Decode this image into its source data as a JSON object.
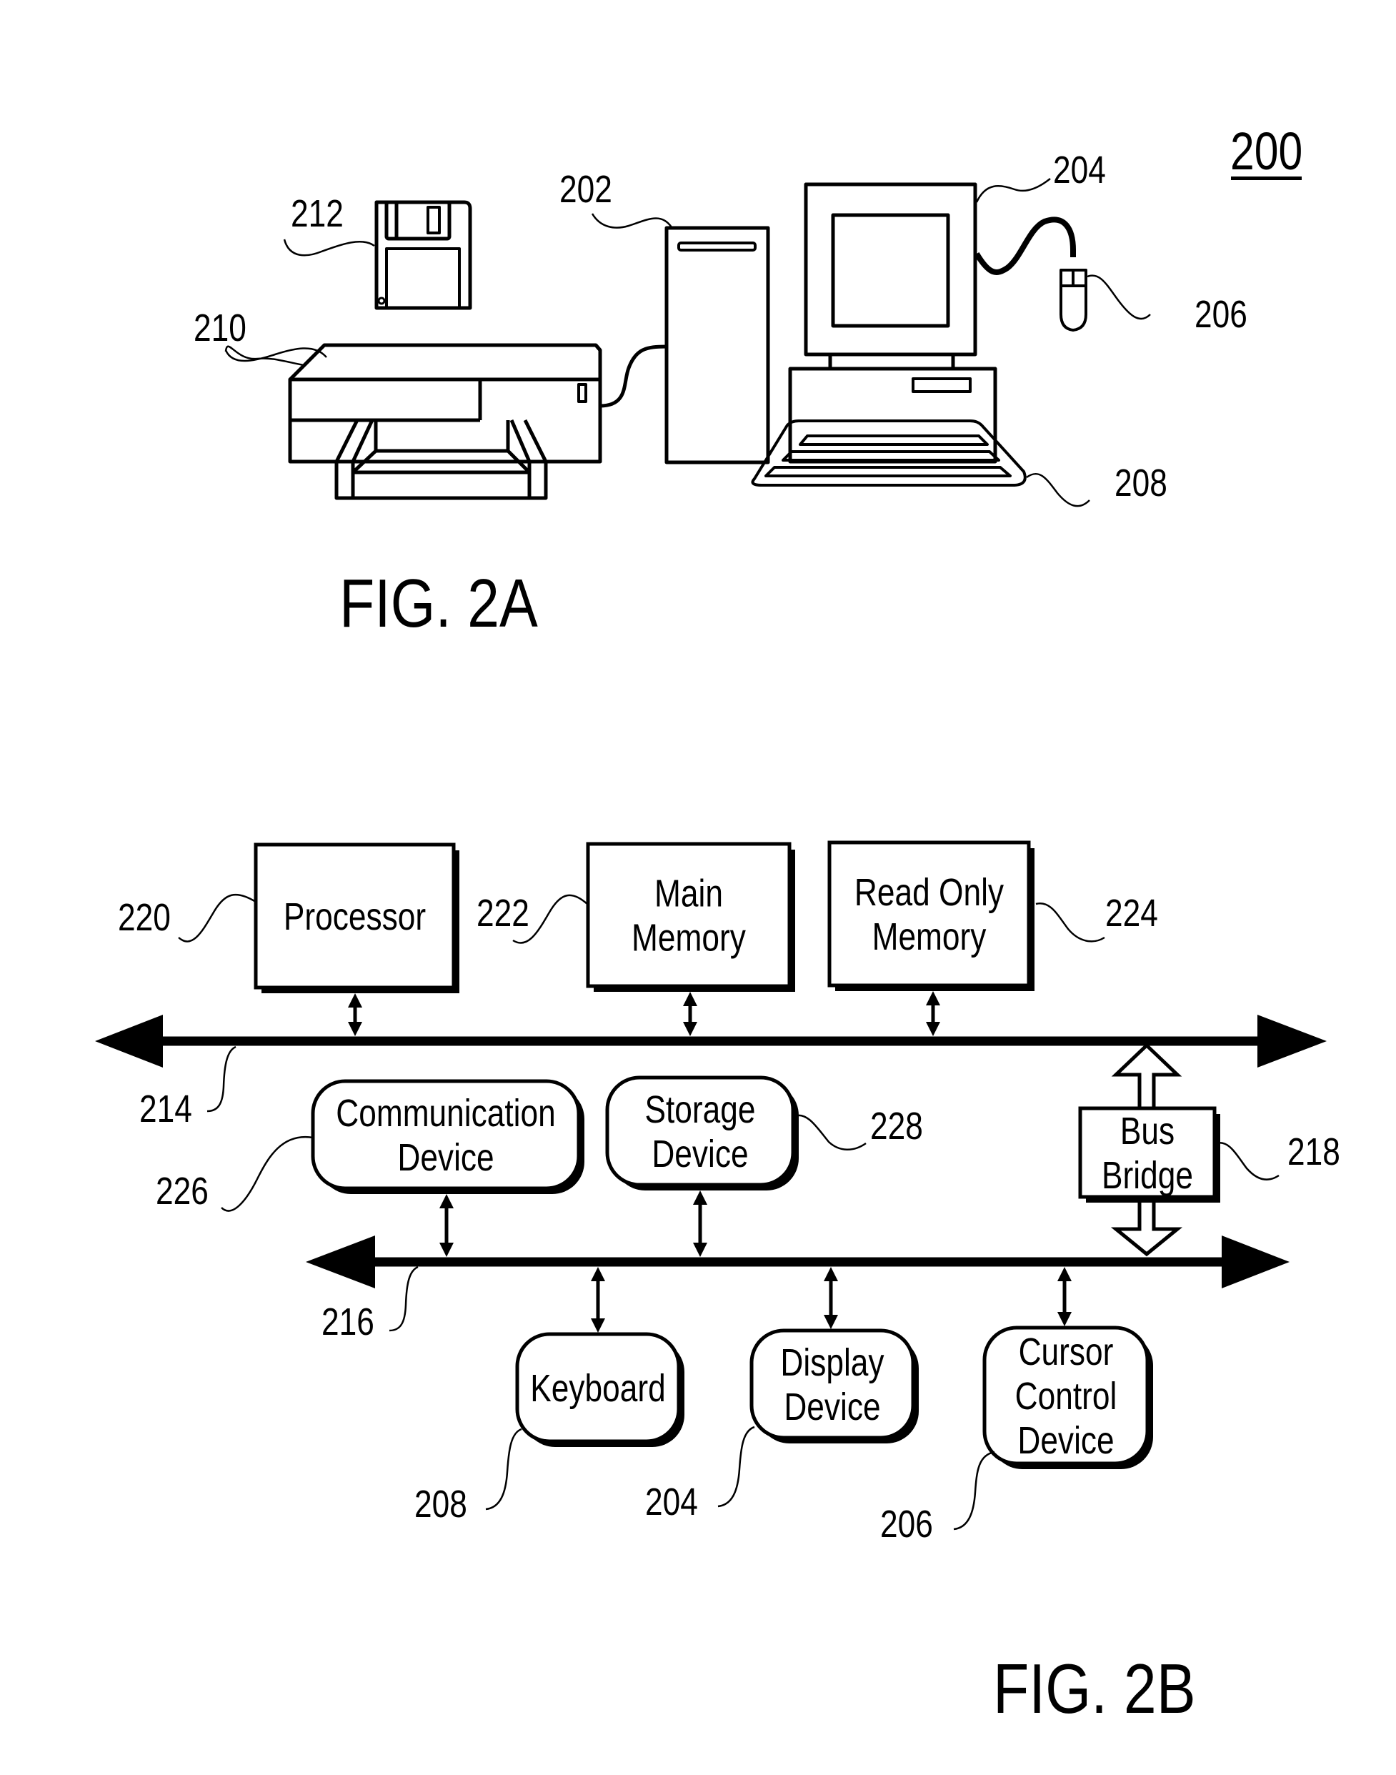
{
  "figure_number": "200",
  "fig2a": {
    "caption": "FIG. 2A",
    "components": [
      {
        "ref": "202",
        "name": "computer-tower"
      },
      {
        "ref": "204",
        "name": "monitor"
      },
      {
        "ref": "206",
        "name": "mouse"
      },
      {
        "ref": "208",
        "name": "keyboard"
      },
      {
        "ref": "210",
        "name": "printer"
      },
      {
        "ref": "212",
        "name": "floppy-disk"
      }
    ]
  },
  "fig2b": {
    "caption": "FIG. 2B",
    "buses": [
      {
        "ref": "214",
        "name": "upper-bus"
      },
      {
        "ref": "216",
        "name": "lower-bus"
      }
    ],
    "bridge": {
      "ref": "218",
      "lines": [
        "Bus",
        "Bridge"
      ]
    },
    "upper_blocks": [
      {
        "ref": "220",
        "lines": [
          "Processor"
        ]
      },
      {
        "ref": "222",
        "lines": [
          "Main",
          "Memory"
        ]
      },
      {
        "ref": "224",
        "lines": [
          "Read Only",
          "Memory"
        ]
      }
    ],
    "mid_blocks": [
      {
        "ref": "226",
        "lines": [
          "Communication",
          "Device"
        ]
      },
      {
        "ref": "228",
        "lines": [
          "Storage",
          "Device"
        ]
      }
    ],
    "lower_blocks": [
      {
        "ref": "208",
        "lines": [
          "Keyboard"
        ]
      },
      {
        "ref": "204",
        "lines": [
          "Display",
          "Device"
        ]
      },
      {
        "ref": "206",
        "lines": [
          "Cursor",
          "Control",
          "Device"
        ]
      }
    ]
  }
}
